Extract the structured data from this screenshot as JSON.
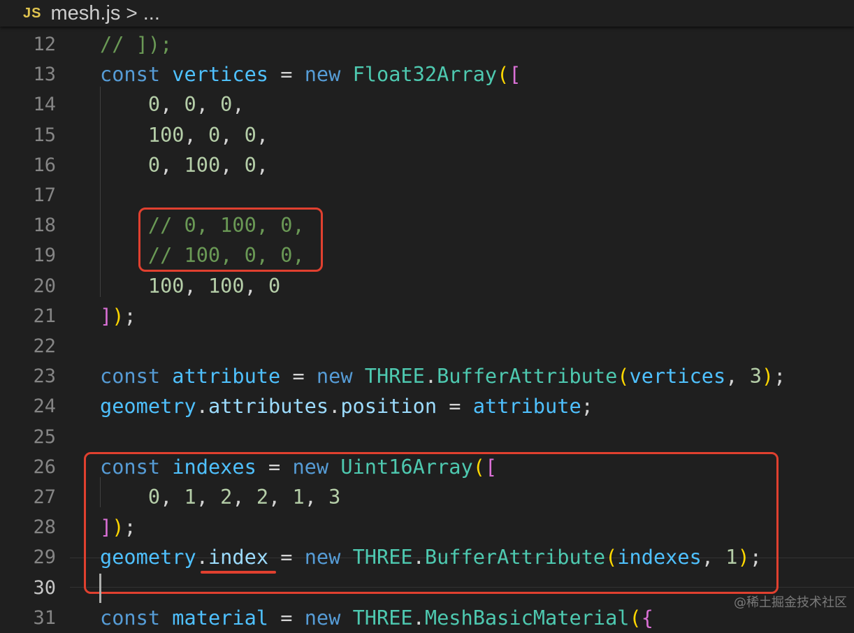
{
  "breadcrumb": {
    "file_icon": "JS",
    "file_name": "mesh.js",
    "separator": ">",
    "ellipsis": "..."
  },
  "editor": {
    "active_line": "30",
    "lines": [
      {
        "n": "12",
        "tokens": [
          [
            "com",
            "// ]);"
          ]
        ]
      },
      {
        "n": "13",
        "tokens": [
          [
            "kw",
            "const "
          ],
          [
            "var",
            "vertices"
          ],
          [
            "p",
            " = "
          ],
          [
            "kw",
            "new "
          ],
          [
            "cls",
            "Float32Array"
          ],
          [
            "b1",
            "("
          ],
          [
            "b2",
            "["
          ]
        ]
      },
      {
        "n": "14",
        "tokens": [
          [
            "num",
            "    0"
          ],
          [
            "p",
            ", "
          ],
          [
            "num",
            "0"
          ],
          [
            "p",
            ", "
          ],
          [
            "num",
            "0"
          ],
          [
            "p",
            ","
          ]
        ]
      },
      {
        "n": "15",
        "tokens": [
          [
            "num",
            "    100"
          ],
          [
            "p",
            ", "
          ],
          [
            "num",
            "0"
          ],
          [
            "p",
            ", "
          ],
          [
            "num",
            "0"
          ],
          [
            "p",
            ","
          ]
        ]
      },
      {
        "n": "16",
        "tokens": [
          [
            "num",
            "    0"
          ],
          [
            "p",
            ", "
          ],
          [
            "num",
            "100"
          ],
          [
            "p",
            ", "
          ],
          [
            "num",
            "0"
          ],
          [
            "p",
            ","
          ]
        ]
      },
      {
        "n": "17",
        "tokens": []
      },
      {
        "n": "18",
        "tokens": [
          [
            "com",
            "    // 0, 100, 0,"
          ]
        ]
      },
      {
        "n": "19",
        "tokens": [
          [
            "com",
            "    // 100, 0, 0,"
          ]
        ]
      },
      {
        "n": "20",
        "tokens": [
          [
            "num",
            "    100"
          ],
          [
            "p",
            ", "
          ],
          [
            "num",
            "100"
          ],
          [
            "p",
            ", "
          ],
          [
            "num",
            "0"
          ]
        ]
      },
      {
        "n": "21",
        "tokens": [
          [
            "b2",
            "]"
          ],
          [
            "b1",
            ")"
          ],
          [
            "p",
            ";"
          ]
        ]
      },
      {
        "n": "22",
        "tokens": []
      },
      {
        "n": "23",
        "tokens": [
          [
            "kw",
            "const "
          ],
          [
            "var",
            "attribute"
          ],
          [
            "p",
            " = "
          ],
          [
            "kw",
            "new "
          ],
          [
            "cls",
            "THREE"
          ],
          [
            "p",
            "."
          ],
          [
            "cls",
            "BufferAttribute"
          ],
          [
            "b1",
            "("
          ],
          [
            "var",
            "vertices"
          ],
          [
            "p",
            ", "
          ],
          [
            "num",
            "3"
          ],
          [
            "b1",
            ")"
          ],
          [
            "p",
            ";"
          ]
        ]
      },
      {
        "n": "24",
        "tokens": [
          [
            "var",
            "geometry"
          ],
          [
            "p",
            "."
          ],
          [
            "prop",
            "attributes"
          ],
          [
            "p",
            "."
          ],
          [
            "prop",
            "position"
          ],
          [
            "p",
            " = "
          ],
          [
            "var",
            "attribute"
          ],
          [
            "p",
            ";"
          ]
        ]
      },
      {
        "n": "25",
        "tokens": []
      },
      {
        "n": "26",
        "tokens": [
          [
            "kw",
            "const "
          ],
          [
            "var",
            "indexes"
          ],
          [
            "p",
            " = "
          ],
          [
            "kw",
            "new "
          ],
          [
            "cls",
            "Uint16Array"
          ],
          [
            "b1",
            "("
          ],
          [
            "b2",
            "["
          ]
        ]
      },
      {
        "n": "27",
        "tokens": [
          [
            "num",
            "    0"
          ],
          [
            "p",
            ", "
          ],
          [
            "num",
            "1"
          ],
          [
            "p",
            ", "
          ],
          [
            "num",
            "2"
          ],
          [
            "p",
            ", "
          ],
          [
            "num",
            "2"
          ],
          [
            "p",
            ", "
          ],
          [
            "num",
            "1"
          ],
          [
            "p",
            ", "
          ],
          [
            "num",
            "3"
          ]
        ]
      },
      {
        "n": "28",
        "tokens": [
          [
            "b2",
            "]"
          ],
          [
            "b1",
            ")"
          ],
          [
            "p",
            ";"
          ]
        ]
      },
      {
        "n": "29",
        "tokens": [
          [
            "var",
            "geometry"
          ],
          [
            "p",
            "."
          ],
          [
            "prop",
            "index"
          ],
          [
            "p",
            " = "
          ],
          [
            "kw",
            "new "
          ],
          [
            "cls",
            "THREE"
          ],
          [
            "p",
            "."
          ],
          [
            "cls",
            "BufferAttribute"
          ],
          [
            "b1",
            "("
          ],
          [
            "var",
            "indexes"
          ],
          [
            "p",
            ", "
          ],
          [
            "num",
            "1"
          ],
          [
            "b1",
            ")"
          ],
          [
            "p",
            ";"
          ]
        ]
      },
      {
        "n": "30",
        "tokens": []
      },
      {
        "n": "31",
        "tokens": [
          [
            "kw",
            "const "
          ],
          [
            "var",
            "material"
          ],
          [
            "p",
            " = "
          ],
          [
            "kw",
            "new "
          ],
          [
            "cls",
            "THREE"
          ],
          [
            "p",
            "."
          ],
          [
            "cls",
            "MeshBasicMaterial"
          ],
          [
            "b1",
            "("
          ],
          [
            "b2",
            "{"
          ]
        ]
      }
    ]
  },
  "watermark": "@稀土掘金技术社区",
  "colors": {
    "highlight": "#e0402f",
    "background": "#1f1f1f"
  }
}
